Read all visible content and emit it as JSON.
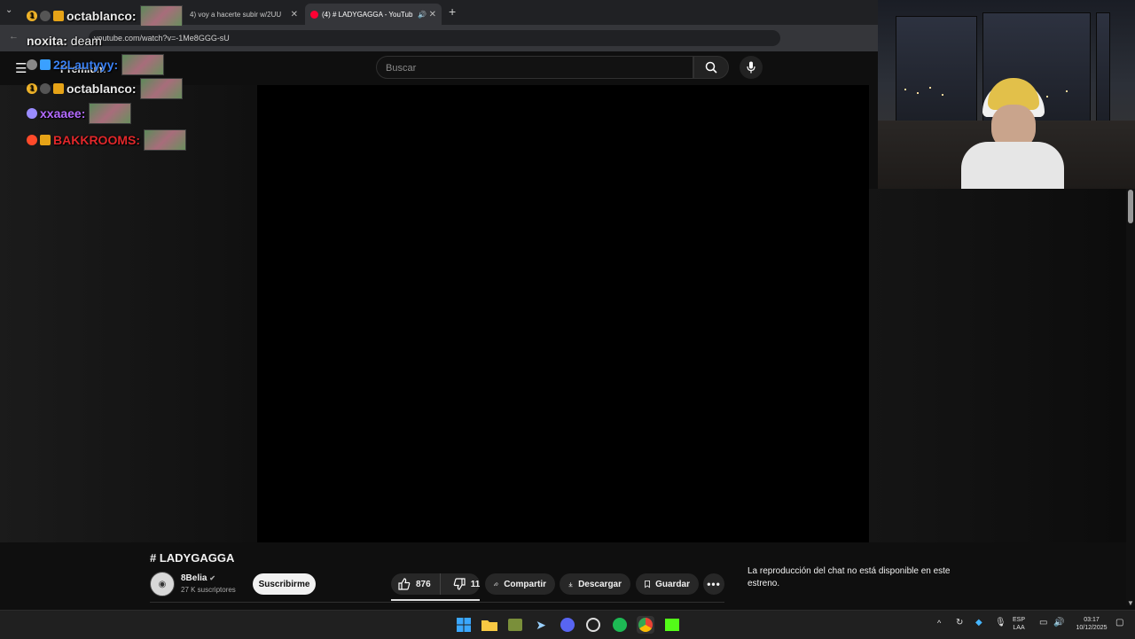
{
  "browser": {
    "tabs": [
      {
        "label": "octablanco",
        "active": false
      },
      {
        "label": "4) voy a hacerte subir w/2UU",
        "active": false
      },
      {
        "label": "(4) # LADYGAGGA - YouTub",
        "active": true
      }
    ],
    "new_tab_label": "+",
    "url": "youtube.com/watch?v=-1Me8GGG-sU"
  },
  "youtube": {
    "premium_label": "Premium",
    "search_placeholder": "Buscar",
    "video_title": "# LADYGAGGA",
    "channel_name": "8Belia",
    "channel_subs": "27 K suscriptores",
    "subscribe_label": "Suscribirme",
    "like_count": "876",
    "dislike_count": "11",
    "share_label": "Compartir",
    "download_label": "Descargar",
    "save_label": "Guardar",
    "chat_unavailable": "La reproducción del chat no está disponible en este estreno."
  },
  "stream_chat": [
    {
      "user": "noxita",
      "message": "deam",
      "color": "#e8e8e8"
    },
    {
      "user": "octablanco",
      "message": "",
      "color": "#e8e8e8"
    },
    {
      "user": "22Lautyyy",
      "message": "",
      "color": "#3b82f6"
    },
    {
      "user": "octablanco",
      "message": "",
      "color": "#e8e8e8"
    },
    {
      "user": "xxaaee",
      "message": "",
      "color": "#b36bff"
    },
    {
      "user": "BAKKROOMS",
      "message": "",
      "color": "#e0282b"
    }
  ],
  "taskbar": {
    "lang": "ESP",
    "layout": "LAA",
    "time": "03:17",
    "date": "10/12/2025"
  },
  "colors": {
    "bg": "#0f0f0f",
    "accent_red": "#ff0000"
  }
}
